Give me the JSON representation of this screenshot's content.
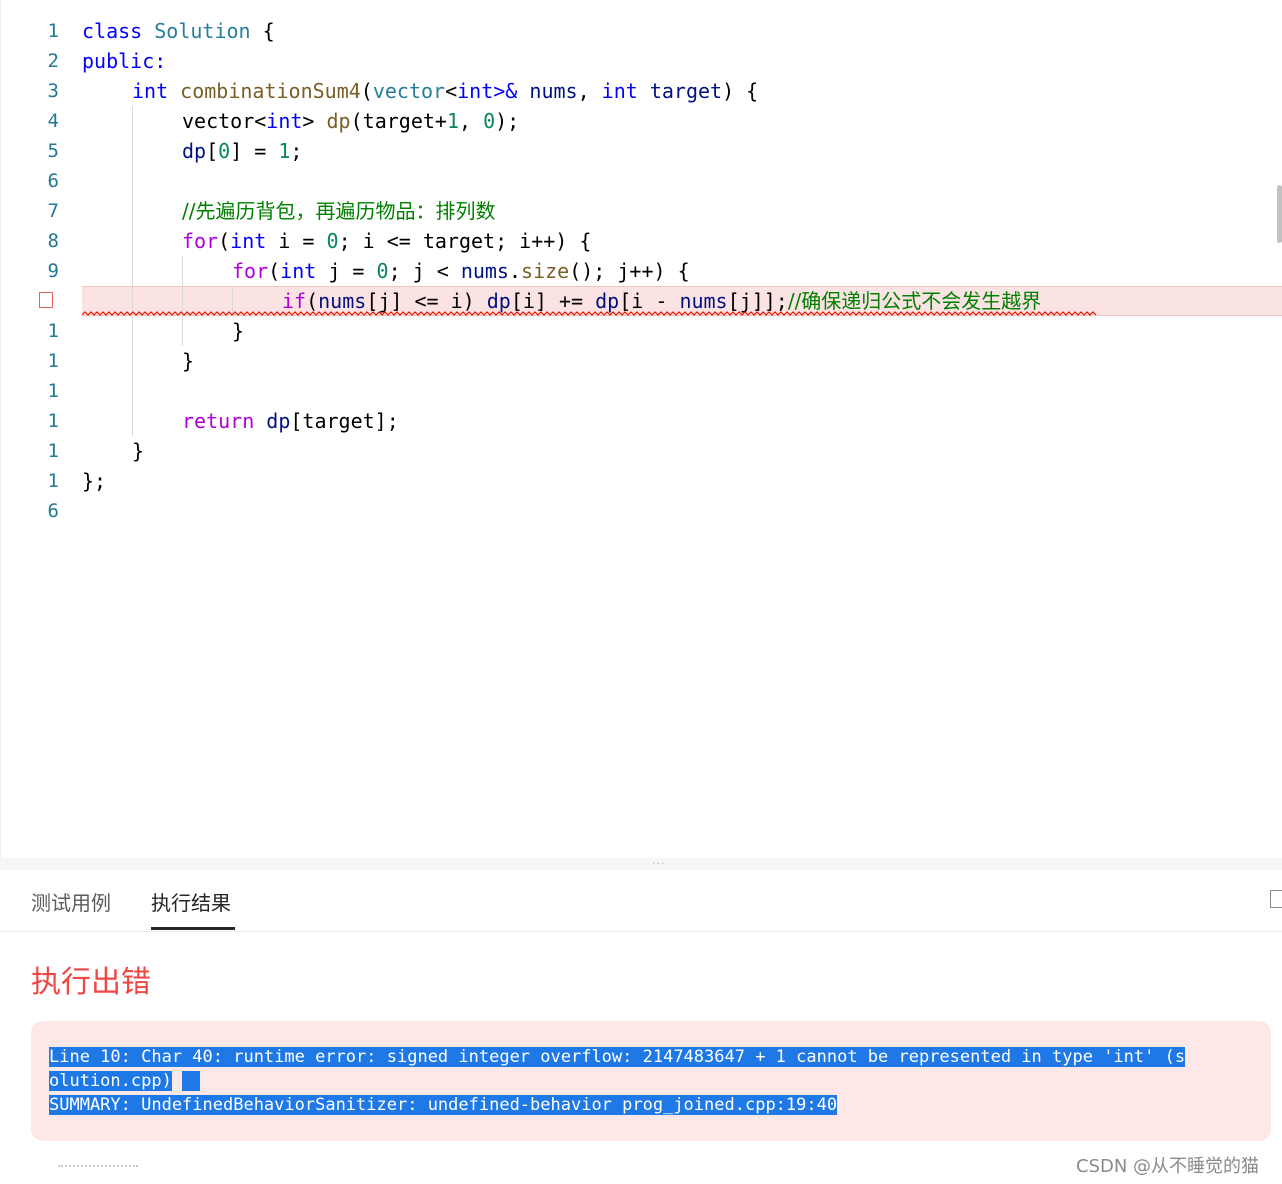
{
  "editor": {
    "line_numbers": [
      "1",
      "2",
      "3",
      "4",
      "5",
      "6",
      "7",
      "8",
      "9",
      "",
      "1",
      "1",
      "1",
      "1",
      "1",
      "1",
      "6"
    ],
    "code": {
      "l1_class": "class",
      "l1_name": "Solution",
      "l1_brace": " {",
      "l2": "public:",
      "l3_int": "int",
      "l3_fn": "combinationSum4",
      "l3_p1": "(",
      "l3_vec": "vector",
      "l3_lt": "<",
      "l3_int2": "int",
      "l3_gt": ">&",
      "l3_nums": "nums",
      "l3_comma": ", ",
      "l3_int3": "int",
      "l3_target": "target",
      "l3_end": ") {",
      "l4_a": "vector<",
      "l4_int": "int",
      "l4_b": "> ",
      "l4_dp": "dp",
      "l4_c": "(target+",
      "l4_one": "1",
      "l4_d": ", ",
      "l4_zero": "0",
      "l4_e": ");",
      "l5_dp": "dp",
      "l5_a": "[",
      "l5_zero": "0",
      "l5_b": "] = ",
      "l5_one": "1",
      "l5_c": ";",
      "l7_comment": "//先遍历背包，再遍历物品：排列数",
      "l8_for": "for",
      "l8_a": "(",
      "l8_int": "int",
      "l8_b": " i = ",
      "l8_zero": "0",
      "l8_c": "; i <= target; i++) {",
      "l9_for": "for",
      "l9_a": "(",
      "l9_int": "int",
      "l9_b": " j = ",
      "l9_zero": "0",
      "l9_c": "; j < ",
      "l9_nums": "nums",
      "l9_d": ".",
      "l9_size": "size",
      "l9_e": "(); j++) {",
      "l10_if": "if",
      "l10_a": "(",
      "l10_nums": "nums",
      "l10_b": "[j] <= i) ",
      "l10_dp": "dp",
      "l10_c": "[i] += ",
      "l10_dp2": "dp",
      "l10_d": "[i - ",
      "l10_nums2": "nums",
      "l10_e": "[j]];",
      "l10_comment": "//确保递归公式不会发生越界",
      "l11": "}",
      "l12": "}",
      "l14_return": "return",
      "l14_dp": "dp",
      "l14_a": "[target];",
      "l15": "}",
      "l16": "};"
    }
  },
  "panel": {
    "tabs": [
      "测试用例",
      "执行结果"
    ],
    "active_tab": "执行结果",
    "result_title": "执行出错",
    "error_line1": "Line 10: Char 40: runtime error: signed integer overflow: 2147483647 + 1 cannot be represented in type 'int' (s",
    "error_line2": "olution.cpp)",
    "error_line3": "SUMMARY: UndefinedBehaviorSanitizer: undefined-behavior prog_joined.cpp:19:40"
  },
  "watermark": "CSDN @从不睡觉的猫",
  "colors": {
    "error_red": "#ef4743",
    "error_bg": "#fde7e7",
    "selection": "#1e78e6",
    "line_number": "#237893"
  }
}
